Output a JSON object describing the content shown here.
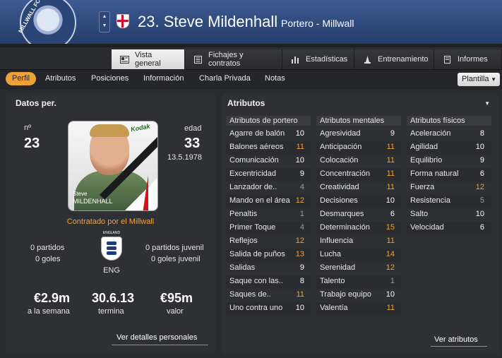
{
  "header": {
    "crest_text": "MILLWALL FC",
    "title": "23. Steve Mildenhall",
    "subtitle": "Portero - Millwall",
    "stepper_up": "▲",
    "stepper_down": "▼"
  },
  "main_tabs": [
    {
      "label": "Vista general",
      "icon": "overview-icon",
      "active": true
    },
    {
      "label": "Fichajes y contratos",
      "icon": "contract-icon",
      "active": false
    },
    {
      "label": "Estadísticas",
      "icon": "stats-icon",
      "active": false
    },
    {
      "label": "Entrenamiento",
      "icon": "training-icon",
      "active": false
    },
    {
      "label": "Informes",
      "icon": "reports-icon",
      "active": false
    }
  ],
  "subtabs": {
    "perfil": "Perfil",
    "items": [
      "Atributos",
      "Posiciones",
      "Información",
      "Charla Privada",
      "Notas"
    ],
    "plantilla": "Plantilla"
  },
  "personal": {
    "panel_title": "Datos per.",
    "number_label": "nº",
    "number": "23",
    "age_label": "edad",
    "age": "33",
    "dob": "13.5.1978",
    "photo_name_first": "Steve",
    "photo_name_last": "MILDENHALL",
    "photo_sponsor": "Kodak",
    "contract": "Contratado por el Millwall",
    "nation_label": "ENGLAND",
    "nation_code": "ENG",
    "senior_matches": "0 partidos",
    "senior_goals": "0 goles",
    "youth_matches": "0 partidos juvenil",
    "youth_goals": "0 goles juvenil",
    "wage": "€2.9m",
    "wage_label": "a la semana",
    "expiry": "30.6.13",
    "expiry_label": "termina",
    "value": "€95m",
    "value_label": "valor",
    "details_link": "Ver detalles personales"
  },
  "attributes": {
    "panel_title": "Atributos",
    "link": "Ver atributos",
    "columns": [
      {
        "title": "Atributos de portero",
        "rows": [
          {
            "name": "Agarre de balón",
            "value": "10",
            "tone": "white"
          },
          {
            "name": "Balones aéreos",
            "value": "11",
            "tone": "yellow"
          },
          {
            "name": "Comunicación",
            "value": "10",
            "tone": "white"
          },
          {
            "name": "Excentricidad",
            "value": "9",
            "tone": "white"
          },
          {
            "name": "Lanzador de..",
            "value": "4",
            "tone": "gray"
          },
          {
            "name": "Mando en el área",
            "value": "12",
            "tone": "yellow"
          },
          {
            "name": "Penaltis",
            "value": "1",
            "tone": "gray"
          },
          {
            "name": "Primer Toque",
            "value": "4",
            "tone": "gray"
          },
          {
            "name": "Reflejos",
            "value": "12",
            "tone": "yellow"
          },
          {
            "name": "Salida de puños",
            "value": "13",
            "tone": "yellow"
          },
          {
            "name": "Salidas",
            "value": "9",
            "tone": "white"
          },
          {
            "name": "Saque con las..",
            "value": "8",
            "tone": "white"
          },
          {
            "name": "Saques de..",
            "value": "11",
            "tone": "yellow"
          },
          {
            "name": "Uno contra uno",
            "value": "10",
            "tone": "white"
          }
        ]
      },
      {
        "title": "Atributos mentales",
        "rows": [
          {
            "name": "Agresividad",
            "value": "9",
            "tone": "white"
          },
          {
            "name": "Anticipación",
            "value": "11",
            "tone": "yellow"
          },
          {
            "name": "Colocación",
            "value": "11",
            "tone": "yellow"
          },
          {
            "name": "Concentración",
            "value": "11",
            "tone": "yellow"
          },
          {
            "name": "Creatividad",
            "value": "11",
            "tone": "yellow"
          },
          {
            "name": "Decisiones",
            "value": "10",
            "tone": "white"
          },
          {
            "name": "Desmarques",
            "value": "6",
            "tone": "white"
          },
          {
            "name": "Determinación",
            "value": "15",
            "tone": "yellow"
          },
          {
            "name": "Influencia",
            "value": "11",
            "tone": "yellow"
          },
          {
            "name": "Lucha",
            "value": "14",
            "tone": "yellow"
          },
          {
            "name": "Serenidad",
            "value": "12",
            "tone": "yellow"
          },
          {
            "name": "Talento",
            "value": "1",
            "tone": "gray"
          },
          {
            "name": "Trabajo equipo",
            "value": "10",
            "tone": "white"
          },
          {
            "name": "Valentía",
            "value": "11",
            "tone": "yellow"
          }
        ]
      },
      {
        "title": "Atributos físicos",
        "rows": [
          {
            "name": "Aceleración",
            "value": "8",
            "tone": "white"
          },
          {
            "name": "Agilidad",
            "value": "10",
            "tone": "white"
          },
          {
            "name": "Equilibrio",
            "value": "9",
            "tone": "white"
          },
          {
            "name": "Forma natural",
            "value": "6",
            "tone": "white"
          },
          {
            "name": "Fuerza",
            "value": "12",
            "tone": "yellow"
          },
          {
            "name": "Resistencia",
            "value": "5",
            "tone": "gray"
          },
          {
            "name": "Salto",
            "value": "10",
            "tone": "white"
          },
          {
            "name": "Velocidad",
            "value": "6",
            "tone": "white"
          }
        ]
      }
    ]
  },
  "colors": {
    "accent": "#f0a23a",
    "header": "#2f4a80",
    "panel": "#2f3034"
  }
}
